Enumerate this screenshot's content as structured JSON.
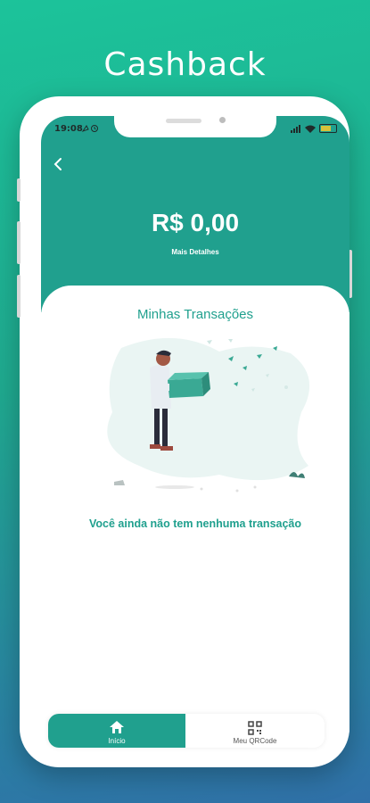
{
  "promo": {
    "title": "Cashback"
  },
  "status_bar": {
    "time": "19:08"
  },
  "header": {
    "balance": "R$ 0,00",
    "details_label": "Mais Detalhes"
  },
  "transactions": {
    "title": "Minhas Transações",
    "empty_message": "Você ainda não tem nenhuma transação"
  },
  "bottom_nav": {
    "items": [
      {
        "label": "Início",
        "icon": "home-icon",
        "active": true
      },
      {
        "label": "Meu QRCode",
        "icon": "qrcode-icon",
        "active": false
      }
    ]
  },
  "colors": {
    "primary": "#20a08e",
    "white": "#ffffff"
  }
}
